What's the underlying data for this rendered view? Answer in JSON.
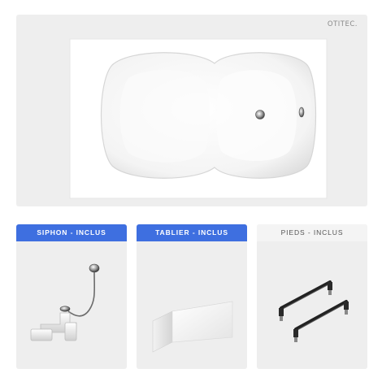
{
  "hero": {
    "brand": "OTITEC."
  },
  "cards": [
    {
      "label": "SIPHON - INCLUS"
    },
    {
      "label": "TABLIER - INCLUS"
    },
    {
      "label": "PIEDS - INCLUS"
    }
  ],
  "colors": {
    "accent": "#3e6fe0",
    "panel": "#eeeeee"
  }
}
